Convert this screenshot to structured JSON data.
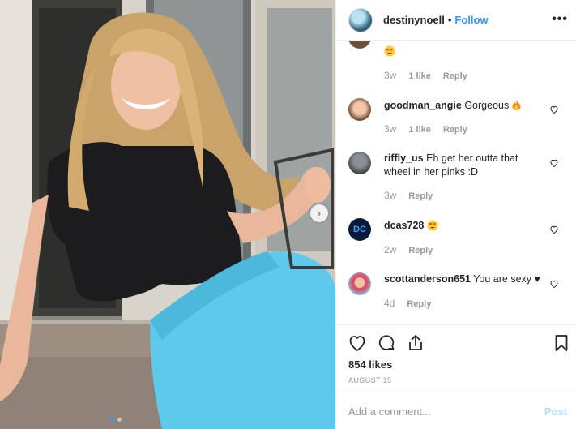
{
  "post": {
    "author": "destinynoell",
    "separator": "•",
    "follow_label": "Follow",
    "more_label": "•••",
    "carousel_next": "›",
    "slide_count": 2,
    "active_slide": 1
  },
  "comments": [
    {
      "username": "",
      "text": "",
      "emoji": "heart-eyes",
      "ago": "3w",
      "likes": "1 like",
      "reply": "Reply"
    },
    {
      "username": "goodman_angie",
      "text": "Gorgeous",
      "emoji": "fire",
      "ago": "3w",
      "likes": "1 like",
      "reply": "Reply"
    },
    {
      "username": "riffly_us",
      "text": "Eh get her outta that wheel in her pinks :D",
      "ago": "3w",
      "reply": "Reply"
    },
    {
      "username": "dcas728",
      "text": "",
      "emoji": "heart-eyes",
      "ago": "2w",
      "reply": "Reply"
    },
    {
      "username": "scottanderson651",
      "text": "You are sexy ♥",
      "ago": "4d",
      "reply": "Reply"
    }
  ],
  "dcas_avatar_text": "DC",
  "stats": {
    "likes": "854 likes",
    "date": "AUGUST 15"
  },
  "composer": {
    "placeholder": "Add a comment...",
    "post_label": "Post"
  },
  "colors": {
    "link_blue": "#3897f0",
    "post_disabled": "#b2dffc",
    "meta_gray": "#999999",
    "sweatpants_blue": "#5ec9ea"
  },
  "icons": [
    "heart-icon",
    "comment-icon",
    "share-icon",
    "bookmark-icon",
    "more-options-icon",
    "carousel-next-icon"
  ]
}
